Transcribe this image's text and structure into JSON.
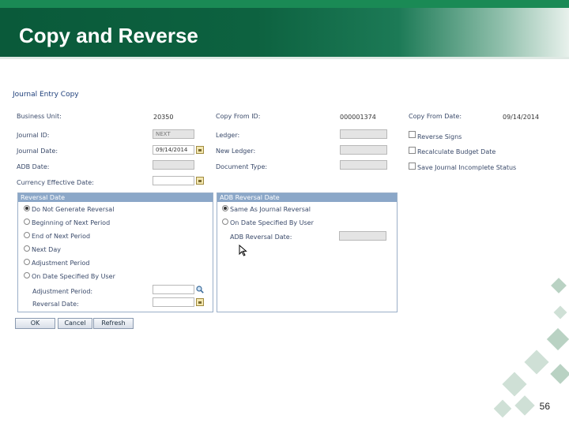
{
  "slide": {
    "title": "Copy and Reverse",
    "page_number": "56"
  },
  "form": {
    "heading": "Journal Entry Copy",
    "business_unit_label": "Business Unit:",
    "business_unit_value": "20350",
    "copy_from_id_label": "Copy From ID:",
    "copy_from_id_value": "000001374",
    "copy_from_date_label": "Copy From Date:",
    "copy_from_date_value": "09/14/2014",
    "journal_id_label": "Journal ID:",
    "journal_id_value": "NEXT",
    "ledger_label": "Ledger:",
    "journal_date_label": "Journal Date:",
    "journal_date_value": "09/14/2014",
    "new_ledger_label": "New Ledger:",
    "adb_date_label": "ADB Date:",
    "document_type_label": "Document Type:",
    "currency_effective_date_label": "Currency Effective Date:",
    "reverse_signs_label": "Reverse Signs",
    "recalc_budget_label": "Recalculate Budget Date",
    "save_incomplete_label": "Save Journal Incomplete Status"
  },
  "reversal": {
    "header": "Reversal Date",
    "options": [
      "Do Not Generate Reversal",
      "Beginning of Next Period",
      "End of Next Period",
      "Next Day",
      "Adjustment Period",
      "On Date Specified By User"
    ],
    "adjustment_period_label": "Adjustment Period:",
    "reversal_date_label": "Reversal Date:"
  },
  "adb_reversal": {
    "header": "ADB Reversal Date",
    "options": [
      "Same As Journal Reversal",
      "On Date Specified By User"
    ],
    "adb_reversal_date_label": "ADB Reversal Date:"
  },
  "buttons": {
    "ok": "OK",
    "cancel": "Cancel",
    "refresh": "Refresh"
  },
  "colors": {
    "banner": "#0d6240",
    "group_header": "#8ba7c8",
    "label": "#3a4a6a"
  },
  "icons": [
    "calendar-icon",
    "lookup-icon",
    "mouse-cursor-icon"
  ]
}
